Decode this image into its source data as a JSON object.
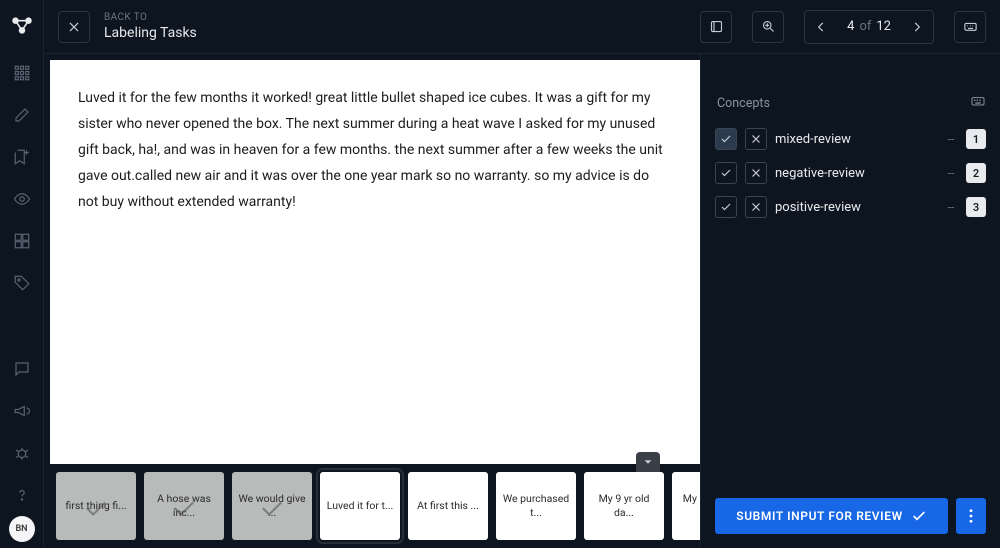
{
  "header": {
    "back_to": "BACK TO",
    "title": "Labeling Tasks",
    "pager": {
      "current": "4",
      "of": "of",
      "total": "12"
    }
  },
  "document": {
    "text": "Luved it for the few months it worked! great little bullet shaped ice cubes. It was a gift for my sister who never opened the box. The next summer during a heat wave I asked for my unused gift back, ha!, and was in heaven for a few months. the next summer after a few weeks the unit gave out.called new air and it was over the one year mark so no warranty. so my advice is do not buy without extended warranty!"
  },
  "filmstrip": {
    "items": [
      {
        "label": "first thing fi...",
        "done": true,
        "active": false
      },
      {
        "label": "A hose was inc...",
        "done": true,
        "active": false
      },
      {
        "label": "We would give ...",
        "done": true,
        "active": false
      },
      {
        "label": "Luved it for t...",
        "done": false,
        "active": true
      },
      {
        "label": "At first this ...",
        "done": false,
        "active": false
      },
      {
        "label": "We purchased t...",
        "done": false,
        "active": false
      },
      {
        "label": "My 9 yr old da...",
        "done": false,
        "active": false
      },
      {
        "label": "My daughter lo...",
        "done": false,
        "active": false
      }
    ]
  },
  "panel": {
    "heading": "Concepts",
    "concepts": [
      {
        "name": "mixed-review",
        "status": "--",
        "key": "1",
        "checked": true
      },
      {
        "name": "negative-review",
        "status": "--",
        "key": "2",
        "checked": false
      },
      {
        "name": "positive-review",
        "status": "--",
        "key": "3",
        "checked": false
      }
    ],
    "submit_label": "SUBMIT INPUT FOR REVIEW"
  },
  "avatar": {
    "initials": "BN"
  }
}
